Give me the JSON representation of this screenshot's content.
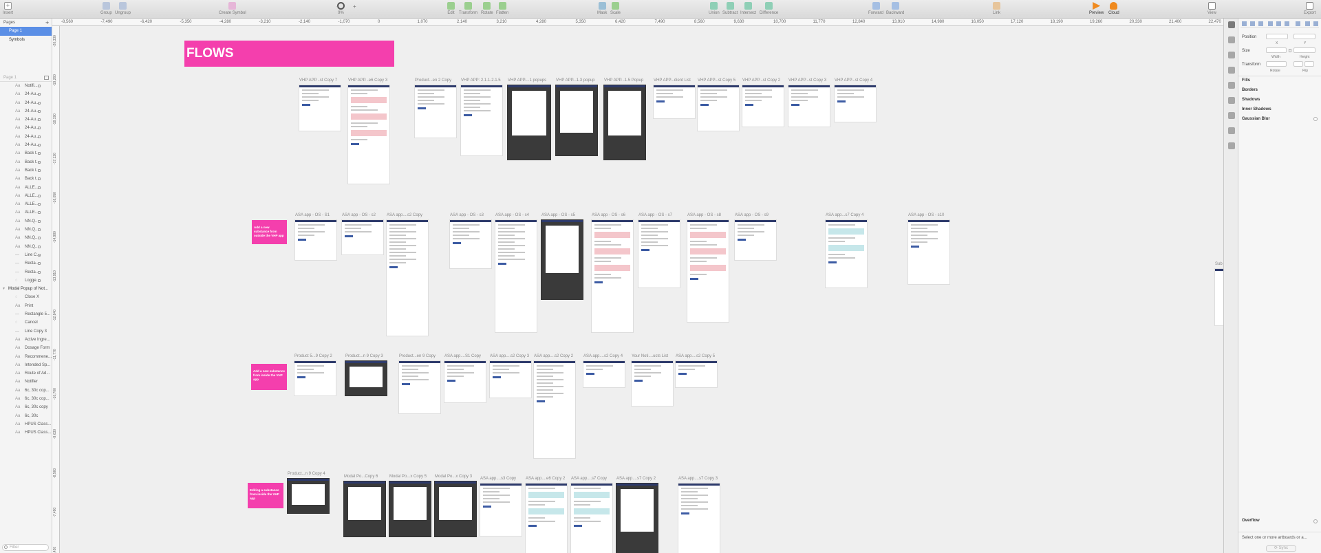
{
  "toolbar": {
    "insert": "Insert",
    "group": "Group",
    "ungroup": "Ungroup",
    "create_symbol": "Create Symbol",
    "zoom": "9%",
    "zoom_minus": "-",
    "zoom_plus": "+",
    "edit": "Edit",
    "transform": "Transform",
    "rotate": "Rotate",
    "flatten": "Flatten",
    "mask": "Mask",
    "scale": "Scale",
    "union": "Union",
    "subtract": "Subtract",
    "intersect": "Intersect",
    "difference": "Difference",
    "forward": "Forward",
    "backward": "Backward",
    "link": "Link",
    "preview": "Preview",
    "cloud": "Cloud",
    "view": "View",
    "export": "Export"
  },
  "pages": {
    "header": "Pages",
    "add": "+",
    "items": [
      "Page 1",
      "Symbols"
    ]
  },
  "layers": {
    "header": "Page 1",
    "items": [
      {
        "type": "Aa",
        "name": "Notifi..."
      },
      {
        "type": "Aa",
        "name": "24-Au..."
      },
      {
        "type": "Aa",
        "name": "24-Au..."
      },
      {
        "type": "Aa",
        "name": "24-Au..."
      },
      {
        "type": "Aa",
        "name": "24-Au..."
      },
      {
        "type": "Aa",
        "name": "24-Au..."
      },
      {
        "type": "Aa",
        "name": "24-Au..."
      },
      {
        "type": "Aa",
        "name": "24-Au..."
      },
      {
        "type": "Aa",
        "name": "Back t..."
      },
      {
        "type": "Aa",
        "name": "Back t..."
      },
      {
        "type": "Aa",
        "name": "Back t..."
      },
      {
        "type": "Aa",
        "name": "Back t..."
      },
      {
        "type": "Aa",
        "name": "ALLE..."
      },
      {
        "type": "Aa",
        "name": "ALLE..."
      },
      {
        "type": "Aa",
        "name": "ALLE..."
      },
      {
        "type": "Aa",
        "name": "ALLE..."
      },
      {
        "type": "Aa",
        "name": "NN.Q..."
      },
      {
        "type": "Aa",
        "name": "NN.Q..."
      },
      {
        "type": "Aa",
        "name": "NN.Q..."
      },
      {
        "type": "Aa",
        "name": "NN.Q..."
      },
      {
        "type": "—",
        "name": "Line C..."
      },
      {
        "type": "—",
        "name": "Recta..."
      },
      {
        "type": "—",
        "name": "Recta..."
      },
      {
        "type": "◌",
        "name": "Logge..."
      }
    ],
    "group": "Modal Popup of Not...",
    "group_items": [
      {
        "type": "◌",
        "name": "Close X"
      },
      {
        "type": "Aa",
        "name": "Print"
      },
      {
        "type": "—",
        "name": "Rectangle 5..."
      },
      {
        "type": "◌",
        "name": "Cancel"
      },
      {
        "type": "—",
        "name": "Line Copy 3"
      },
      {
        "type": "Aa",
        "name": "Active Ingre..."
      },
      {
        "type": "Aa",
        "name": "Dosage Form"
      },
      {
        "type": "Aa",
        "name": "Recommene..."
      },
      {
        "type": "Aa",
        "name": "Intended Sp..."
      },
      {
        "type": "Aa",
        "name": "Route of Ad..."
      },
      {
        "type": "Aa",
        "name": "Notifier"
      },
      {
        "type": "Aa",
        "name": "6c, 30c cop..."
      },
      {
        "type": "Aa",
        "name": "6c, 30c cop..."
      },
      {
        "type": "Aa",
        "name": "6c, 30c copy"
      },
      {
        "type": "Aa",
        "name": "6c, 30c"
      },
      {
        "type": "Aa",
        "name": "HPUS Class..."
      },
      {
        "type": "Aa",
        "name": "HPUS Class..."
      }
    ],
    "filter_placeholder": "Filter"
  },
  "ruler": {
    "h_ticks": [
      "-8,560",
      "-7,490",
      "-6,420",
      "-5,350",
      "-4,280",
      "-3,210",
      "-2,140",
      "-1,070",
      "0",
      "1,070",
      "2,140",
      "3,210",
      "4,280",
      "5,350",
      "6,420",
      "7,490",
      "8,560",
      "9,630",
      "10,700",
      "11,770",
      "12,840",
      "13,910",
      "14,980",
      "16,050",
      "17,120",
      "18,190",
      "19,260",
      "20,330",
      "21,400",
      "22,470"
    ],
    "v_ticks": [
      "-20,330",
      "-19,260",
      "-18,190",
      "-17,120",
      "-16,050",
      "-14,980",
      "-13,910",
      "-12,840",
      "-11,770",
      "-10,700",
      "-9,630",
      "-8,560",
      "-7,490",
      "-6,420"
    ]
  },
  "canvas": {
    "title": "FLOWS",
    "notes": [
      "Add a new substance from outside the VHP app",
      "Add a new substance from inside the VHP app",
      "Editing a substance from inside the VHP app"
    ],
    "row1": [
      "VHP APP...st Copy 7",
      "VHP APP...e6 Copy 3",
      "Product...en 2 Copy",
      "VHP APP: 2.1.1-2.1.5",
      "VHP APP....1 popups",
      "VHP APP...1.3 popup",
      "VHP APP...1.5 Popup",
      "VHP APP...dient List",
      "VHP APP...st Copy 5",
      "VHP APP...st Copy 2",
      "VHP APP...st Copy 3",
      "VHP APP...st Copy 4"
    ],
    "row2": [
      "ASA app - OS - S1",
      "ASA app - OS - s2",
      "ASA app....s2 Copy",
      "ASA app - OS - s3",
      "ASA app - OS - s4",
      "ASA app - OS - s5",
      "ASA app - OS - s6",
      "ASA app - OS - s7",
      "ASA app - OS - s8",
      "ASA app - OS - s9",
      "ASA app...s7 Copy 4",
      "ASA app - OS - s10"
    ],
    "row3": [
      "Product 5...9 Copy 2",
      "Product...n 9 Copy 3",
      "Product...en 9 Copy",
      "ASA app....S1 Copy",
      "ASA app....s2 Copy 3",
      "ASA app....s2 Copy 2",
      "ASA app....s2 Copy 4",
      "Your Noti....ucts List",
      "ASA app....s2 Copy 5"
    ],
    "row4": [
      "Product...n 9 Copy 4",
      "Modal Po...Copy 6",
      "Modal Po...x Copy 5",
      "Modal Po...x Copy 3",
      "ASA app....s3 Copy",
      "ASA app....e6 Copy 2",
      "ASA app....s7 Copy",
      "ASA app....s7 Copy 2",
      "ASA app....s7 Copy 3"
    ],
    "edge_label": "Sub"
  },
  "inspector": {
    "position": "Position",
    "x": "X",
    "y": "Y",
    "size": "Size",
    "width": "Width",
    "height": "Height",
    "transform": "Transform",
    "rotate": "Rotate",
    "flip": "Flip",
    "fills": "Fills",
    "borders": "Borders",
    "shadows": "Shadows",
    "inner_shadows": "Inner Shadows",
    "gaussian_blur": "Gaussian Blur",
    "overflow": "Overflow",
    "overflow_hint": "Select one or more artboards or a...",
    "sync": "Sync"
  },
  "colors": {
    "accent": "#f43fad",
    "selection": "#5b8fe6",
    "nav": "#2d3a6b"
  }
}
